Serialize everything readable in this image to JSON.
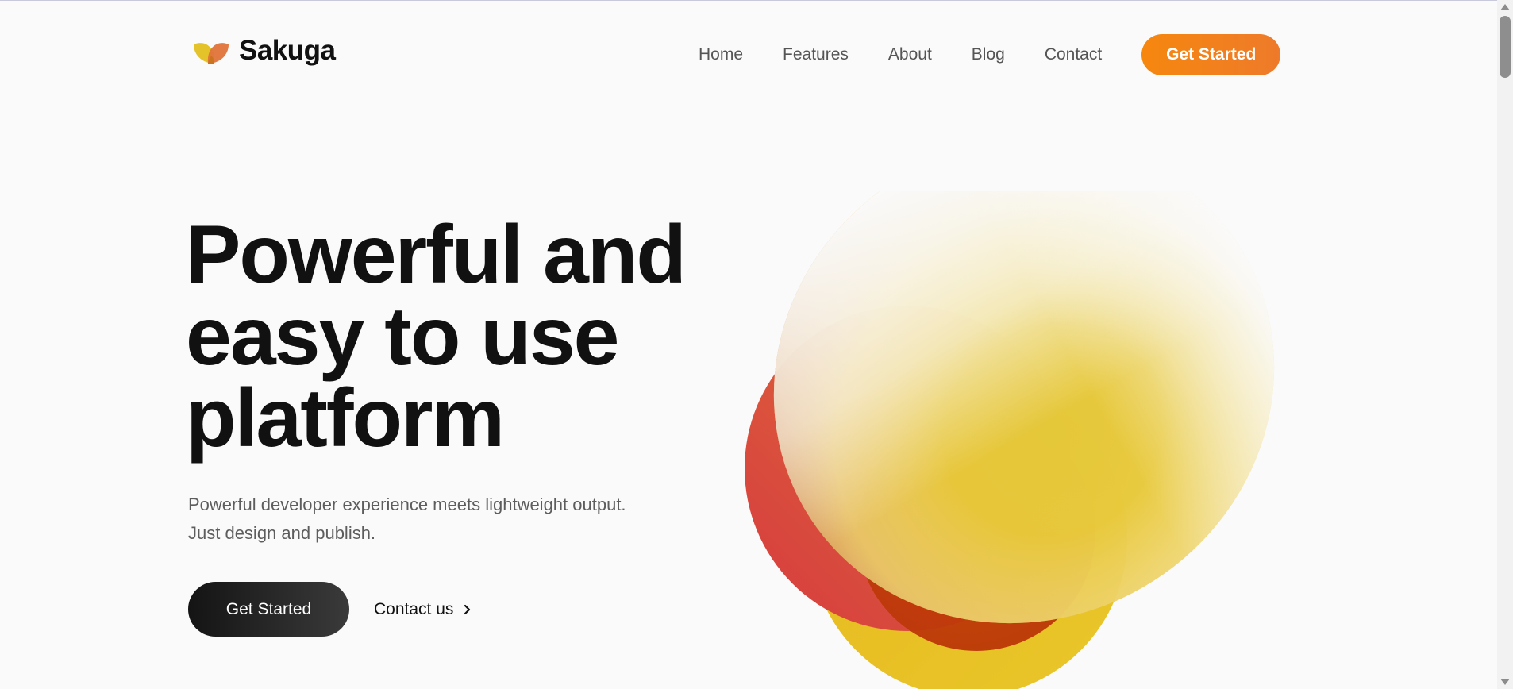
{
  "brand": {
    "name": "Sakuga",
    "logo_icon": "leaf-logo-icon",
    "colors": {
      "logo_left": "#e3c22a",
      "logo_right": "#e0733a",
      "accent": "#f6870e",
      "dark": "#1a1a1a"
    }
  },
  "nav": {
    "items": [
      {
        "label": "Home"
      },
      {
        "label": "Features"
      },
      {
        "label": "About"
      },
      {
        "label": "Blog"
      },
      {
        "label": "Contact"
      }
    ],
    "cta_label": "Get Started"
  },
  "hero": {
    "title_lines": [
      "Powerful and",
      "easy to use",
      "platform"
    ],
    "subtitle": "Powerful developer experience meets lightweight output. Just design and publish.",
    "primary_button": "Get Started",
    "secondary_link": "Contact us",
    "secondary_icon": "chevron-right-icon"
  },
  "art": {
    "description_colors": [
      "#d94a3c",
      "#e8c22a",
      "#f6870e"
    ]
  }
}
